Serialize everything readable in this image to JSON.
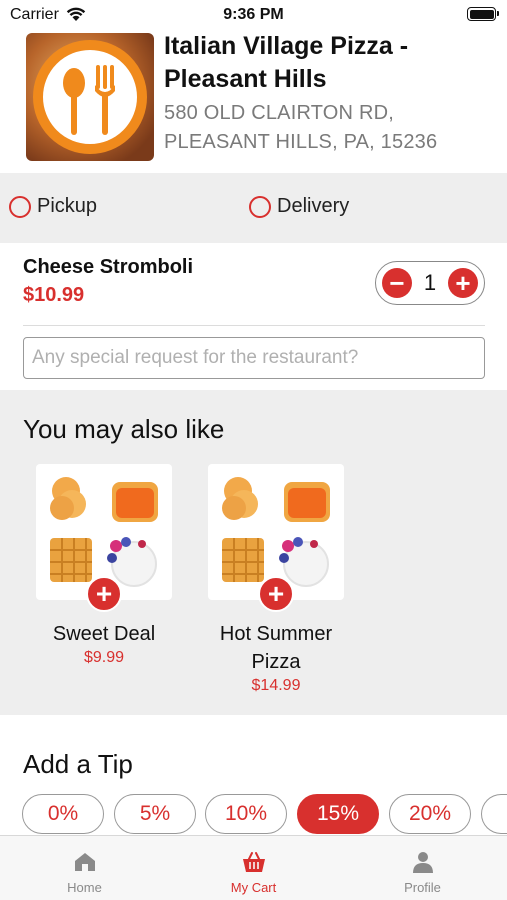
{
  "status_bar": {
    "carrier": "Carrier",
    "time": "9:36 PM"
  },
  "restaurant": {
    "name": "Italian Village Pizza - Pleasant Hills",
    "address": "580 OLD CLAIRTON RD, PLEASANT HILLS, PA, 15236",
    "logo_icon": "fork-spoon-logo-icon"
  },
  "order_type": {
    "options": [
      {
        "label": "Pickup",
        "selected": false
      },
      {
        "label": "Delivery",
        "selected": false
      }
    ]
  },
  "cart_item": {
    "name": "Cheese Stromboli",
    "price": "$10.99",
    "quantity": "1",
    "decrement_label": "−",
    "increment_label": "+",
    "special_request_placeholder": "Any special request for the restaurant?"
  },
  "suggestions": {
    "title": "You may also like",
    "items": [
      {
        "name": "Sweet Deal",
        "price": "$9.99",
        "add_label": "+"
      },
      {
        "name": "Hot Summer Pizza",
        "price": "$14.99",
        "add_label": "+"
      }
    ]
  },
  "tips": {
    "title": "Add a Tip",
    "options": [
      "0%",
      "5%",
      "10%",
      "15%",
      "20%"
    ],
    "selected": "15%"
  },
  "tab_bar": {
    "tabs": [
      {
        "label": "Home",
        "icon": "home-icon",
        "active": false
      },
      {
        "label": "My Cart",
        "icon": "basket-icon",
        "active": true
      },
      {
        "label": "Profile",
        "icon": "person-icon",
        "active": false
      }
    ]
  },
  "colors": {
    "accent": "#d8302e",
    "section_background": "#eeeeee",
    "logo_orange": "#f08a1c"
  }
}
